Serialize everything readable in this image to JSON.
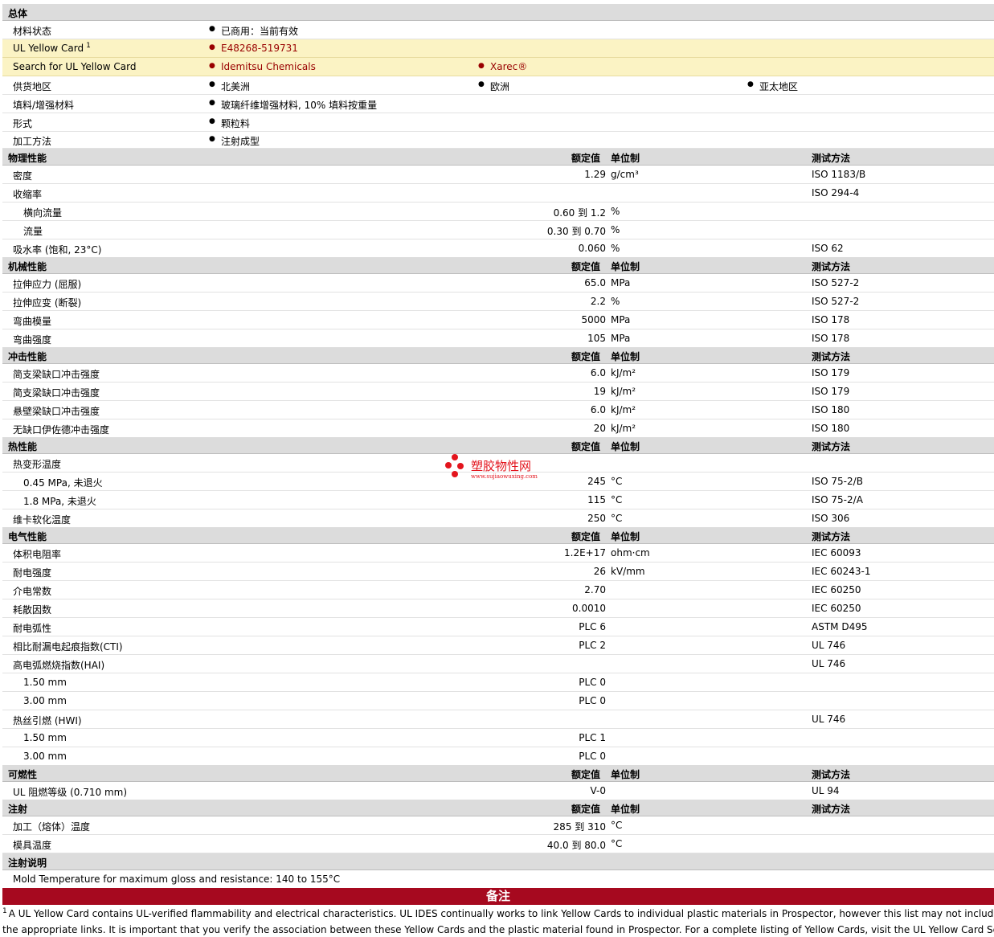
{
  "general": {
    "title": "总体",
    "material_status_label": "材料状态",
    "material_status_value": "已商用：当前有效",
    "yellow_card_label": "UL Yellow Card",
    "yellow_card_sup": "1",
    "yellow_card_value": "E48268-519731",
    "search_label": "Search for UL Yellow Card",
    "search_links": [
      "Idemitsu Chemicals",
      "Xarec®"
    ],
    "supply_label": "供货地区",
    "supply_values": [
      "北美洲",
      "欧洲",
      "亚太地区"
    ],
    "filler_label": "填料/增强材料",
    "filler_value": "玻璃纤维增强材料, 10% 填料按重量",
    "form_label": "形式",
    "form_value": "颗粒料",
    "process_label": "加工方法",
    "process_value": "注射成型"
  },
  "headers": {
    "nominal": "额定值",
    "unit": "单位制",
    "method": "测试方法"
  },
  "physical": {
    "title": "物理性能",
    "rows": [
      {
        "label": "密度",
        "value": "1.29",
        "unit": "g/cm³",
        "method": "ISO 1183/B"
      },
      {
        "label": "收缩率",
        "value": "",
        "unit": "",
        "method": "ISO 294-4"
      },
      {
        "label": "横向流量",
        "value": "0.60 到  1.2",
        "unit": "%",
        "method": ""
      },
      {
        "label": "流量",
        "value": "0.30 到  0.70",
        "unit": "%",
        "method": ""
      },
      {
        "label": "吸水率 (饱和, 23°C)",
        "value": "0.060",
        "unit": "%",
        "method": "ISO 62"
      }
    ]
  },
  "mechanical": {
    "title": "机械性能",
    "rows": [
      {
        "label": "拉伸应力 (屈服)",
        "value": "65.0",
        "unit": "MPa",
        "method": "ISO 527-2"
      },
      {
        "label": "拉伸应变 (断裂)",
        "value": "2.2",
        "unit": "%",
        "method": "ISO 527-2"
      },
      {
        "label": "弯曲模量",
        "value": "5000",
        "unit": "MPa",
        "method": "ISO 178"
      },
      {
        "label": "弯曲强度",
        "value": "105",
        "unit": "MPa",
        "method": "ISO 178"
      }
    ]
  },
  "impact": {
    "title": "冲击性能",
    "rows": [
      {
        "label": "简支梁缺口冲击强度",
        "value": "6.0",
        "unit": "kJ/m²",
        "method": "ISO 179"
      },
      {
        "label": "简支梁缺口冲击强度",
        "value": "19",
        "unit": "kJ/m²",
        "method": "ISO 179"
      },
      {
        "label": "悬壁梁缺口冲击强度",
        "value": "6.0",
        "unit": "kJ/m²",
        "method": "ISO 180"
      },
      {
        "label": "无缺口伊佐德冲击强度",
        "value": "20",
        "unit": "kJ/m²",
        "method": "ISO 180"
      }
    ]
  },
  "thermal": {
    "title": "热性能",
    "rows": [
      {
        "label": "热变形温度",
        "value": "",
        "unit": "",
        "method": ""
      },
      {
        "label": "0.45 MPa, 未退火",
        "value": "245",
        "unit": "°C",
        "method": "ISO 75-2/B"
      },
      {
        "label": "1.8 MPa, 未退火",
        "value": "115",
        "unit": "°C",
        "method": "ISO 75-2/A"
      },
      {
        "label": "维卡软化温度",
        "value": "250",
        "unit": "°C",
        "method": "ISO 306"
      }
    ]
  },
  "electrical": {
    "title": "电气性能",
    "rows": [
      {
        "label": "体积电阻率",
        "value": "1.2E+17",
        "unit": "ohm·cm",
        "method": "IEC 60093"
      },
      {
        "label": "耐电强度",
        "value": "26",
        "unit": "kV/mm",
        "method": "IEC 60243-1"
      },
      {
        "label": "介电常数",
        "value": "2.70",
        "unit": "",
        "method": "IEC 60250"
      },
      {
        "label": "耗散因数",
        "value": "0.0010",
        "unit": "",
        "method": "IEC 60250"
      },
      {
        "label": "耐电弧性",
        "value": "PLC 6",
        "unit": "",
        "method": "ASTM D495"
      },
      {
        "label": "相比耐漏电起痕指数(CTI)",
        "value": "PLC 2",
        "unit": "",
        "method": "UL 746"
      },
      {
        "label": "高电弧燃烧指数(HAI)",
        "value": "",
        "unit": "",
        "method": "UL 746"
      },
      {
        "label": "1.50 mm",
        "value": "PLC 0",
        "unit": "",
        "method": ""
      },
      {
        "label": "3.00 mm",
        "value": "PLC 0",
        "unit": "",
        "method": ""
      },
      {
        "label": "热丝引燃 (HWI)",
        "value": "",
        "unit": "",
        "method": "UL 746"
      },
      {
        "label": "1.50 mm",
        "value": "PLC 1",
        "unit": "",
        "method": ""
      },
      {
        "label": "3.00 mm",
        "value": "PLC 0",
        "unit": "",
        "method": ""
      }
    ]
  },
  "flammability": {
    "title": "可燃性",
    "rows": [
      {
        "label": "UL 阻燃等级 (0.710 mm)",
        "value": "V-0",
        "unit": "",
        "method": "UL 94"
      }
    ]
  },
  "injection": {
    "title": "注射",
    "rows": [
      {
        "label": "加工（熔体）温度",
        "value": "285 到  310",
        "unit": "°C",
        "method": ""
      },
      {
        "label": "模具温度",
        "value": "40.0 到  80.0",
        "unit": "°C",
        "method": ""
      }
    ]
  },
  "injection_notes": {
    "title": "注射说明",
    "text": "Mold Temperature for maximum gloss and resistance: 140 to 155°C"
  },
  "notes": {
    "title": "备注",
    "sup": "1",
    "line1": "A UL Yellow Card contains UL-verified flammability and electrical characteristics. UL IDES continually works to link Yellow Cards to individual plastic materials in Prospector, however this list may not include all of",
    "line2": "the appropriate links. It is important that you verify the association between these Yellow Cards and the plastic material found in Prospector. For a complete listing of Yellow Cards, visit the UL Yellow Card Search."
  },
  "watermark": {
    "text": "塑胶物性网",
    "url": "www.sujiaowuxing.com"
  },
  "colors": {
    "section_bg": "#dcdcdc",
    "highlight_bg": "#fbf3c4",
    "link": "#990000",
    "notes_bar": "#a6091f",
    "watermark": "#e3141d"
  }
}
